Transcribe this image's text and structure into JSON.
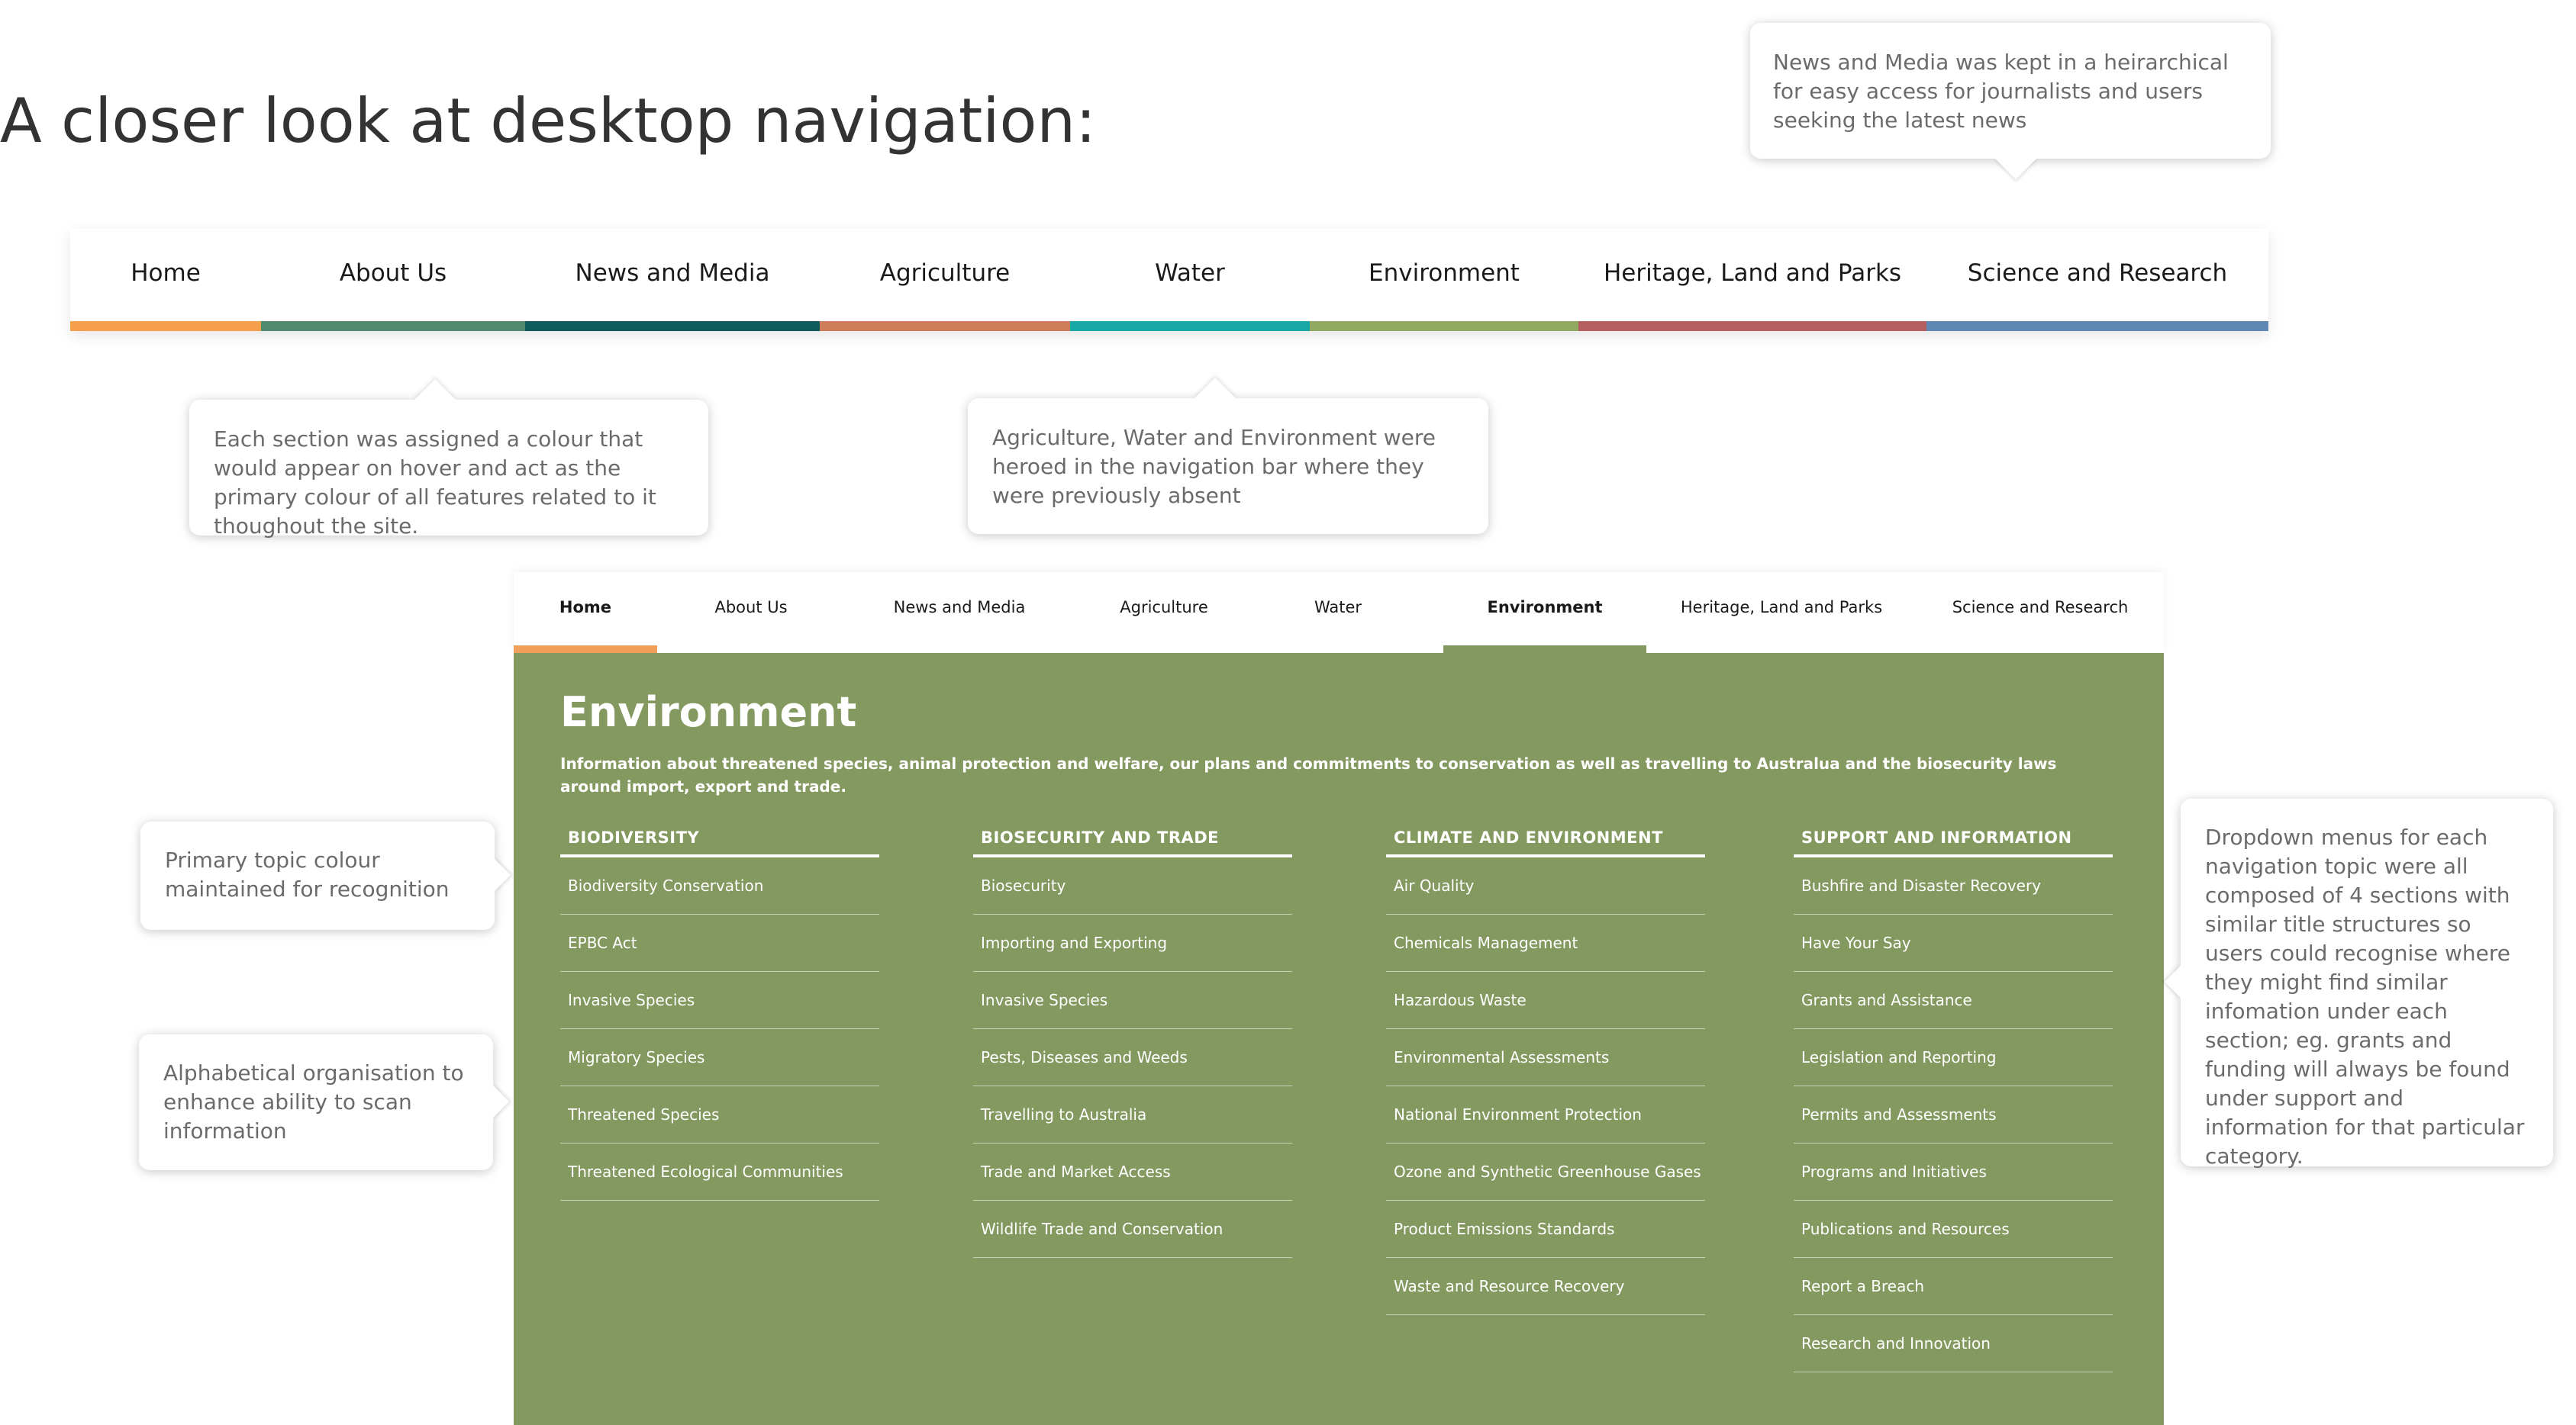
{
  "heading": "A closer look at desktop navigation:",
  "callouts": {
    "news_media": "News and Media was kept in a heirarchical for easy access for journalists and users seeking the latest news",
    "colour": "Each section was assigned a colour that would appear on hover and act as the primary colour of all features related to it thoughout the site.",
    "heroed": "Agriculture, Water and Environment were heroed in the navigation bar where they were previously absent",
    "primary_colour": "Primary topic colour maintained for recognition",
    "alphabetical": "Alphabetical organisation to enhance ability to scan information",
    "dropdown": "Dropdown menus for each navigation topic were all composed of 4 sections with similar title structures so users could recognise where they might find similar infomation under each section; eg. grants and funding will always be found under support and information for that particular category."
  },
  "nav_big": [
    {
      "label": "Home",
      "color": "#f6a04d"
    },
    {
      "label": "About Us",
      "color": "#4f8a70"
    },
    {
      "label": "News and Media",
      "color": "#0e5b5b"
    },
    {
      "label": "Agriculture",
      "color": "#cf7c5b"
    },
    {
      "label": "Water",
      "color": "#17a7a5"
    },
    {
      "label": "Environment",
      "color": "#91aa62"
    },
    {
      "label": "Heritage, Land and Parks",
      "color": "#b65f63"
    },
    {
      "label": "Science and Research",
      "color": "#5f87b4"
    }
  ],
  "nav_small": [
    {
      "label": "Home",
      "color": "#f0a05a"
    },
    {
      "label": "About Us",
      "color": ""
    },
    {
      "label": "News and Media",
      "color": ""
    },
    {
      "label": "Agriculture",
      "color": ""
    },
    {
      "label": "Water",
      "color": ""
    },
    {
      "label": "Environment",
      "color": "#84995f"
    },
    {
      "label": "Heritage, Land and Parks",
      "color": ""
    },
    {
      "label": "Science and Research",
      "color": ""
    }
  ],
  "dropdown": {
    "title": "Environment",
    "description": "Information about threatened species, animal protection and welfare, our plans and commitments to conservation as well as travelling to Australua and the biosecurity laws around import, export and trade.",
    "background": "#84995f",
    "columns": [
      {
        "heading": "BIODIVERSITY",
        "items": [
          "Biodiversity Conservation",
          "EPBC Act",
          "Invasive Species",
          "Migratory Species",
          "Threatened Species",
          "Threatened Ecological Communities"
        ]
      },
      {
        "heading": "BIOSECURITY AND TRADE",
        "items": [
          "Biosecurity",
          "Importing and Exporting",
          "Invasive Species",
          "Pests, Diseases and Weeds",
          "Travelling to Australia",
          "Trade and Market Access",
          "Wildlife Trade and Conservation"
        ]
      },
      {
        "heading": "CLIMATE AND ENVIRONMENT",
        "items": [
          "Air Quality",
          "Chemicals Management",
          "Hazardous Waste",
          "Environmental Assessments",
          "National Environment Protection",
          "Ozone and Synthetic Greenhouse Gases",
          "Product Emissions Standards",
          "Waste and Resource Recovery"
        ]
      },
      {
        "heading": "SUPPORT AND INFORMATION",
        "items": [
          "Bushfire and Disaster Recovery",
          "Have Your Say",
          "Grants and Assistance",
          "Legislation and Reporting",
          "Permits and Assessments",
          "Programs and Initiatives",
          "Publications and Resources",
          "Report a Breach",
          "Research and Innovation"
        ]
      }
    ]
  }
}
